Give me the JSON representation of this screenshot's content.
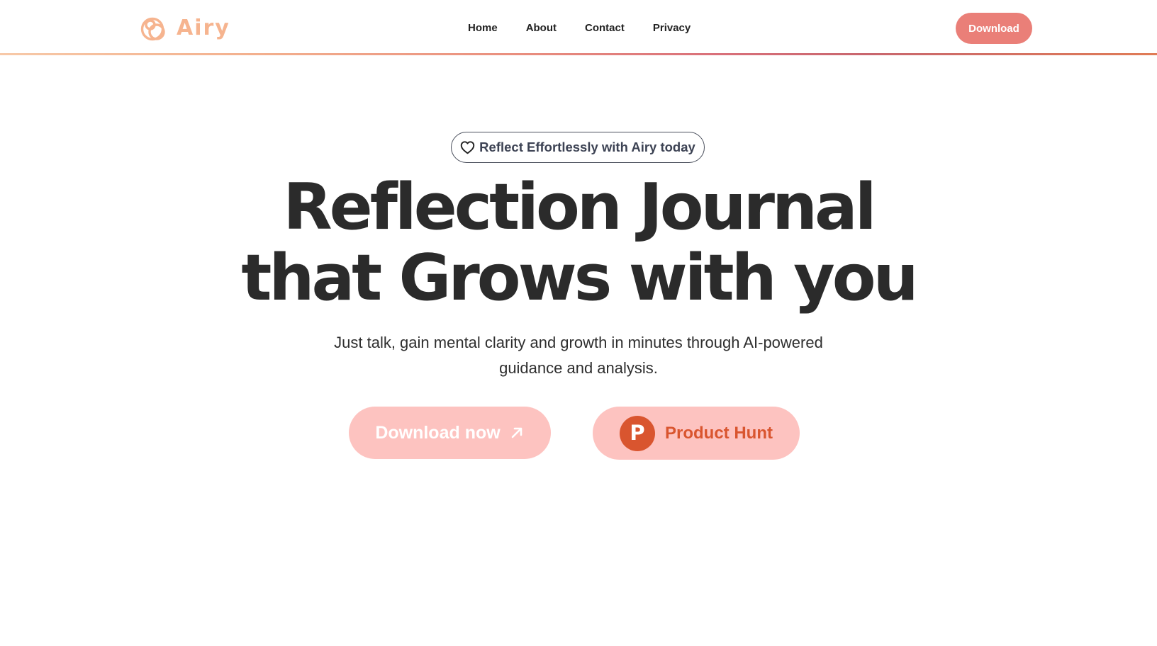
{
  "header": {
    "logo_text": "Airy",
    "nav": [
      {
        "label": "Home"
      },
      {
        "label": "About"
      },
      {
        "label": "Contact"
      },
      {
        "label": "Privacy"
      }
    ],
    "download_label": "Download"
  },
  "hero": {
    "badge_text": "Reflect Effortlessly with Airy today",
    "headline_line1": "Reflection Journal",
    "headline_line2": "that Grows with you",
    "subtitle": "Just talk, gain mental clarity and growth in minutes through AI-powered guidance and analysis.",
    "cta_download_label": "Download now",
    "cta_product_hunt_label": "Product Hunt",
    "product_hunt_icon_letter": "P"
  },
  "icons": {
    "logo": "airy-logo-icon",
    "badge": "heart-icon",
    "cta_download": "arrow-up-right-icon",
    "cta_product_hunt": "product-hunt-icon"
  },
  "colors": {
    "accent": "#ea7f78",
    "logo": "#f6b48f",
    "cta_background": "#fdc3c0",
    "product_hunt": "#d9552f",
    "text_dark": "#2b2b2b"
  }
}
